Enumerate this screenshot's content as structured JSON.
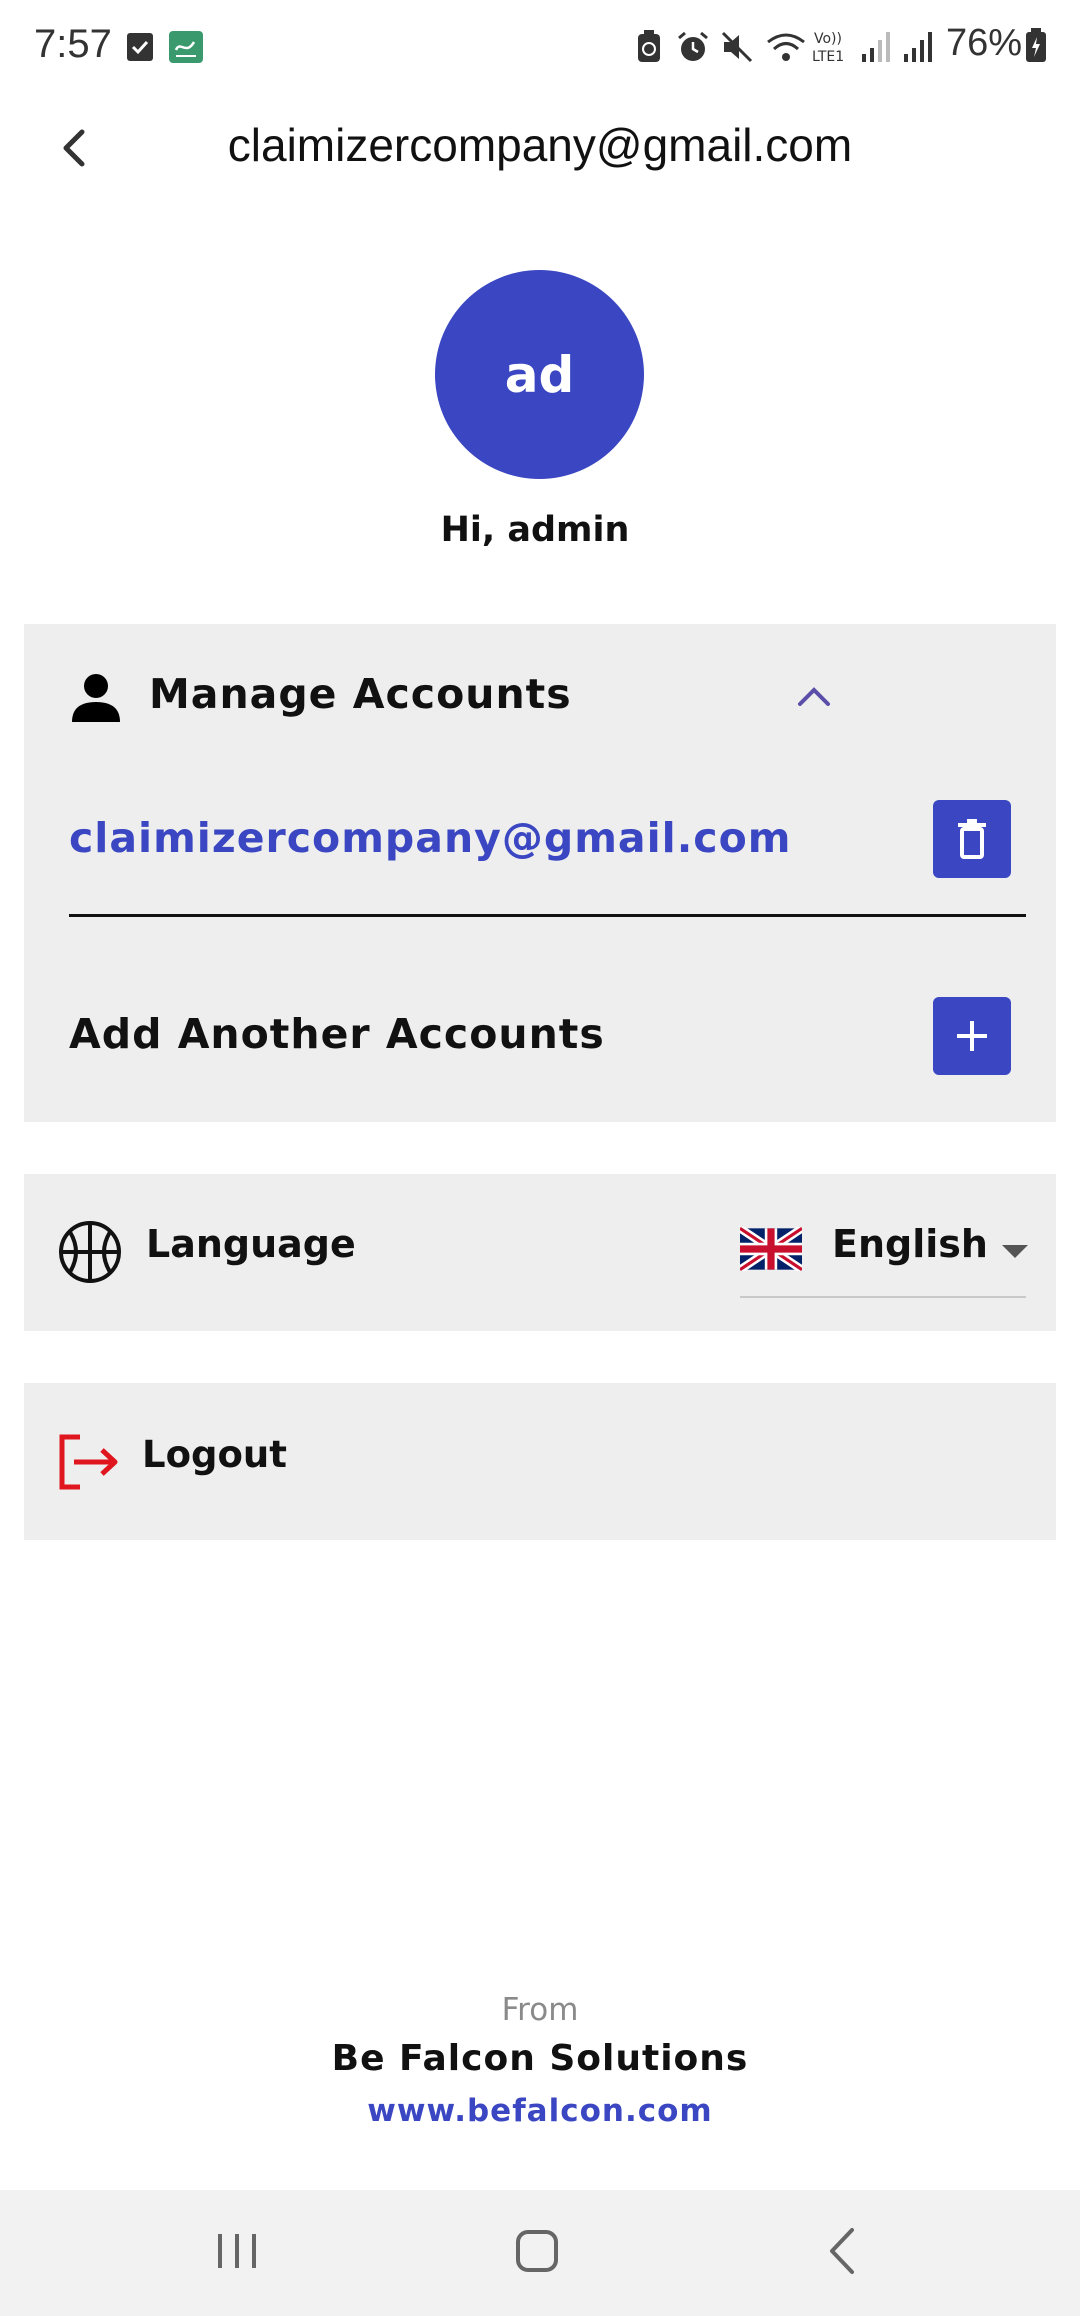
{
  "status_bar": {
    "time": "7:57",
    "battery_text": "76%",
    "icons": [
      "check-notification-icon",
      "app-notification-icon",
      "battery-saver-icon",
      "alarm-icon",
      "mute-icon",
      "wifi-icon",
      "volte-icon",
      "signal-icon",
      "signal-icon",
      "battery-icon"
    ]
  },
  "header": {
    "title": "claimizercompany@gmail.com",
    "back_icon": "chevron-left-icon"
  },
  "profile": {
    "avatar_initials": "ad",
    "greeting": "Hi, admin"
  },
  "manage_accounts": {
    "title": "Manage Accounts",
    "expanded": true,
    "accounts": [
      {
        "email": "claimizercompany@gmail.com",
        "action_icon": "delete-icon"
      }
    ],
    "add_label": "Add Another Accounts",
    "add_icon": "plus-icon"
  },
  "language": {
    "label": "Language",
    "selected": "English",
    "flag": "uk-flag-icon"
  },
  "logout": {
    "label": "Logout"
  },
  "footer": {
    "from": "From",
    "company": "Be Falcon Solutions",
    "link": "www.befalcon.com"
  },
  "colors": {
    "accent": "#3a46c2",
    "card_bg": "#eeeeee",
    "logout_red": "#e0161e"
  }
}
